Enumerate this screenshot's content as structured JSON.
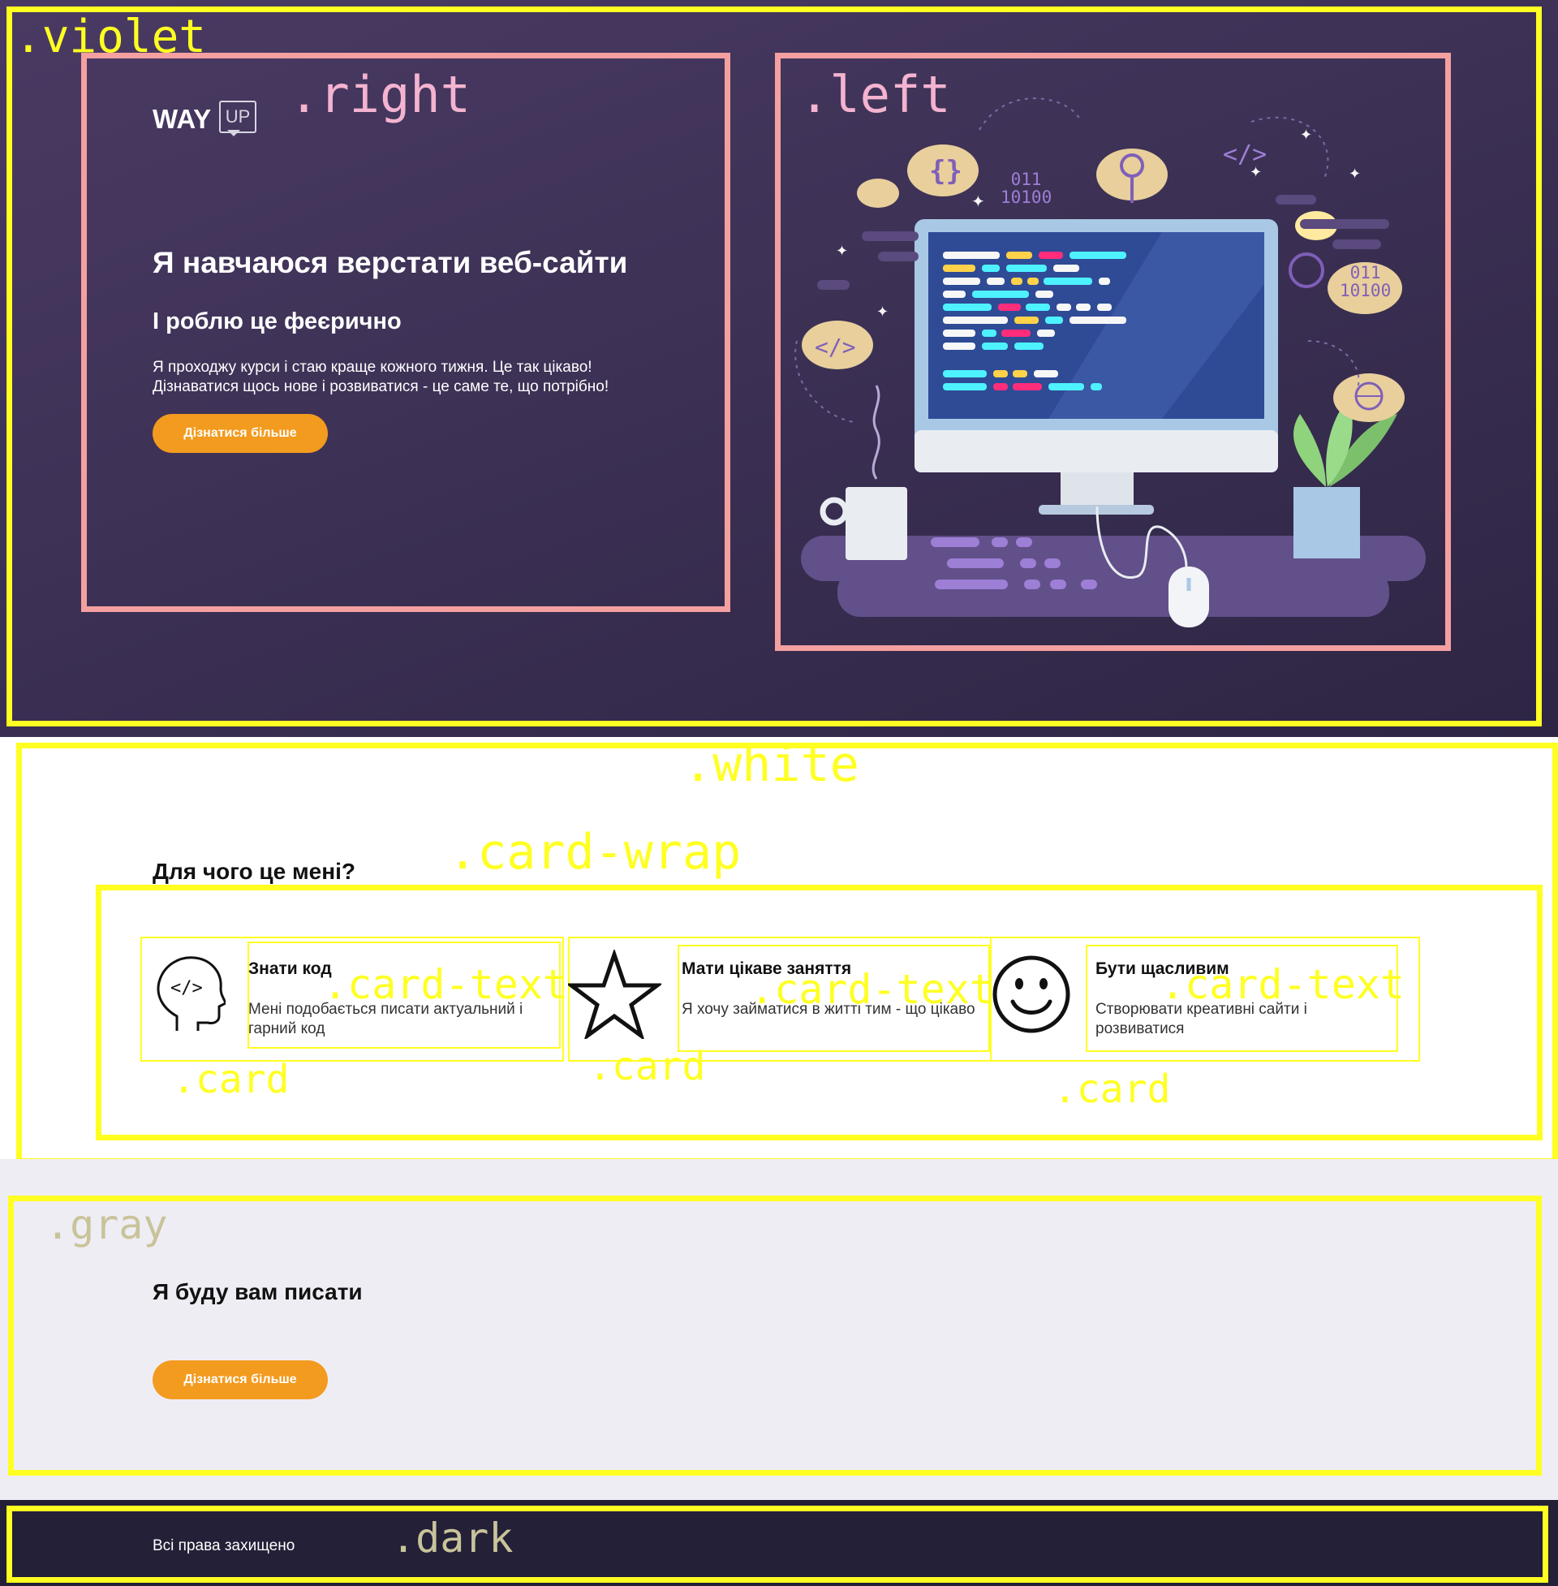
{
  "labels": {
    "violet": ".violet",
    "right": ".right",
    "left": ".left",
    "white": ".white",
    "card_wrap": ".card-wrap",
    "card": ".card",
    "card_text": ".card-text",
    "gray": ".gray",
    "dark": ".dark"
  },
  "logo": {
    "way": "WAY",
    "up": "UP"
  },
  "hero": {
    "title": "Я навчаюся верстати веб-сайти",
    "subtitle": "І роблю це феєрично",
    "text_line1": "Я проходжу курси і стаю краще кожного тижня. Це так цікаво!",
    "text_line2": "Дізнаватися щось нове і розвиватися - це саме те, що потрібно!",
    "button": "Дізнатися більше"
  },
  "illustration": {
    "binary_top": [
      "011",
      "10100"
    ],
    "binary_right": [
      "011",
      "10100"
    ]
  },
  "features": {
    "heading": "Для чого це мені?",
    "cards": [
      {
        "icon": "head-code-icon",
        "title": "Знати код",
        "text": "Мені подобається писати актуальний і гарний код"
      },
      {
        "icon": "star-icon",
        "title": "Мати цікаве заняття",
        "text": "Я хочу займатися в житті тим - що цікаво"
      },
      {
        "icon": "smiley-icon",
        "title": "Бути щасливим",
        "text": "Створювати креативні сайти і розвиватися"
      }
    ]
  },
  "contact": {
    "heading": "Я буду вам писати",
    "button": "Дізнатися більше"
  },
  "footer": {
    "text": "Всі права захищено"
  },
  "colors": {
    "violet": "#3a2f52",
    "accent": "#f39b1f",
    "outline_yellow": "#ffff22",
    "outline_pink": "#f4a0a0",
    "gray": "#efedf4",
    "dark": "#232037"
  }
}
